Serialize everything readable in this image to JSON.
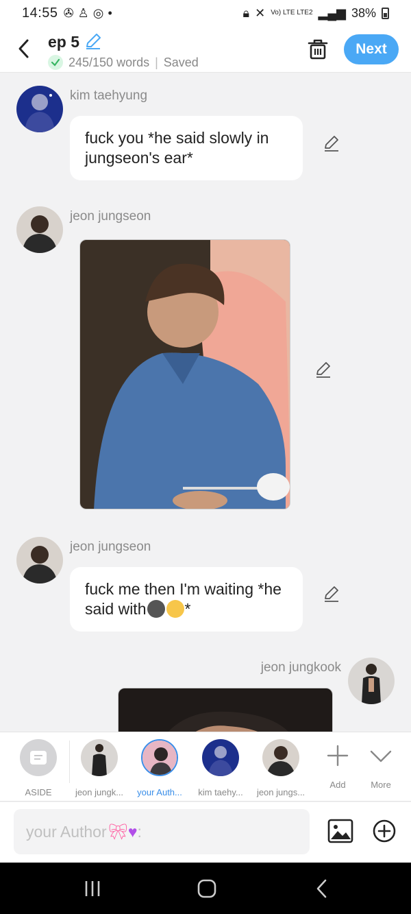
{
  "status": {
    "time": "14:55",
    "battery": "38%",
    "network": "Vo) LTE LTE2"
  },
  "header": {
    "title": "ep 5",
    "word_count": "245/150 words",
    "separator": "|",
    "save_state": "Saved",
    "next_label": "Next"
  },
  "messages": [
    {
      "author": "kim taehyung",
      "type": "text",
      "text": "fuck you *he said slowly in jungseon's ear*"
    },
    {
      "author": "jeon jungseon",
      "type": "image"
    },
    {
      "author": "jeon jungseon",
      "type": "text",
      "text_before": "fuck me then I'm waiting *he said with",
      "text_after": "*"
    },
    {
      "author": "jeon jungkook",
      "type": "image"
    }
  ],
  "characters": [
    {
      "label": "ASIDE"
    },
    {
      "label": "jeon jungk..."
    },
    {
      "label": "your Auth..."
    },
    {
      "label": "kim taehy..."
    },
    {
      "label": "jeon jungs..."
    },
    {
      "label": "Add"
    },
    {
      "label": "More"
    }
  ],
  "input": {
    "placeholder": "your Author",
    "suffix": ":"
  },
  "colors": {
    "accent": "#4aa8f5",
    "active_label": "#3a8ee8",
    "bg": "#f2f2f3"
  }
}
